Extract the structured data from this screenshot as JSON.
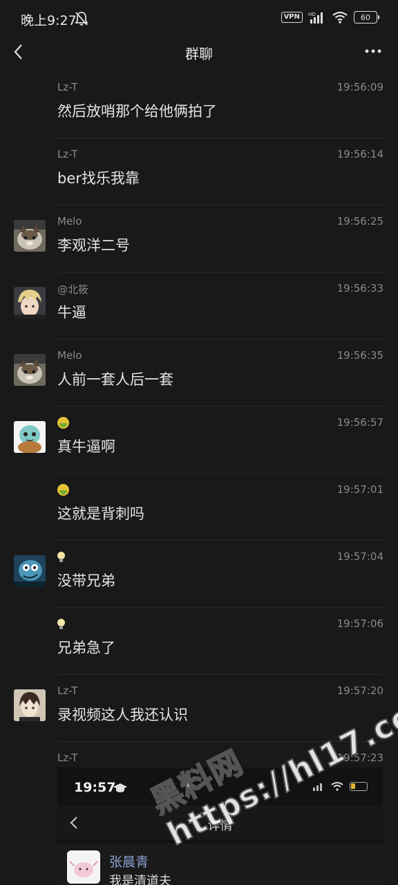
{
  "status_bar": {
    "time": "晚上9:27",
    "vpn_label": "VPN",
    "network": "HD",
    "battery": "60"
  },
  "nav": {
    "title": "群聊"
  },
  "messages": [
    {
      "sender": "Lz-T",
      "time": "19:56:09",
      "text": "然后放哨那个给他俩拍了",
      "avatar": "none"
    },
    {
      "sender": "Lz-T",
      "time": "19:56:14",
      "text": "ber找乐我靠",
      "avatar": "none"
    },
    {
      "sender": "Melo",
      "time": "19:56:25",
      "text": "李观洋二号",
      "avatar": "cat-avatar"
    },
    {
      "sender": "@北筱",
      "time": "19:56:33",
      "text": "牛逼",
      "avatar": "anime-blond-avatar"
    },
    {
      "sender": "Melo",
      "time": "19:56:35",
      "text": "人前一套人后一套",
      "avatar": "cat-avatar"
    },
    {
      "sender": "",
      "sender_icon": "nauseated-face-emoji",
      "time": "19:56:57",
      "text": "真牛逼啊",
      "avatar": "squirtle-avatar"
    },
    {
      "sender": "",
      "sender_icon": "nauseated-face-emoji",
      "time": "19:57:01",
      "text": "这就是背刺吗",
      "avatar": "none"
    },
    {
      "sender": "",
      "sender_icon": "light-bulb-emoji",
      "time": "19:57:04",
      "text": "没带兄弟",
      "avatar": "blue-cartoon-avatar"
    },
    {
      "sender": "",
      "sender_icon": "light-bulb-emoji",
      "time": "19:57:06",
      "text": "兄弟急了",
      "avatar": "none"
    },
    {
      "sender": "Lz-T",
      "time": "19:57:20",
      "text": "录视频这人我还认识",
      "avatar": "anime-boy-avatar"
    }
  ],
  "last_message": {
    "sender": "Lz-T",
    "time": "19:57:23"
  },
  "embedded_screenshot": {
    "time": "19:57",
    "title": "详情",
    "contact_name": "张晨青",
    "contact_sub": "我是清道夫"
  },
  "watermark": "黑料网\nhttps://hl17.co"
}
